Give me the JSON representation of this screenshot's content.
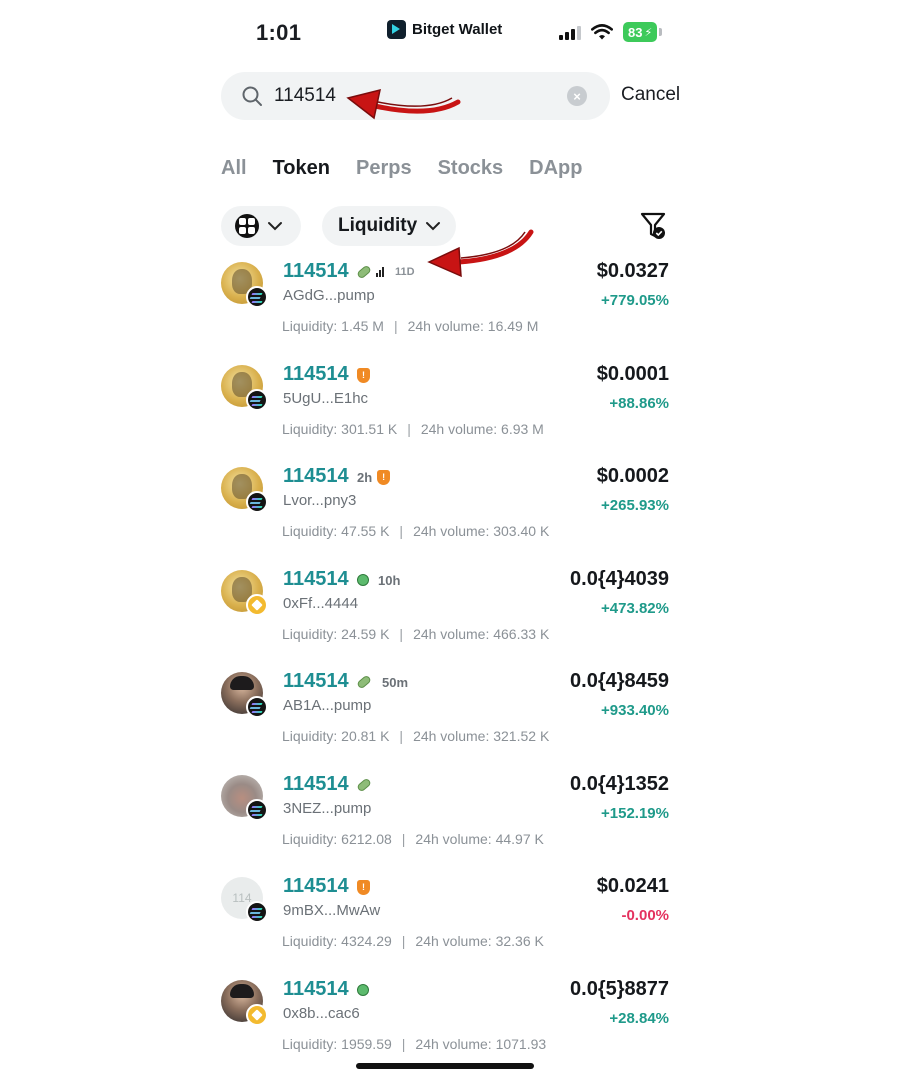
{
  "status_bar": {
    "time": "1:01",
    "brand": "Bitget Wallet",
    "battery": "83"
  },
  "search": {
    "value": "114514",
    "cancel_label": "Cancel"
  },
  "tabs": [
    {
      "label": "All",
      "active": false
    },
    {
      "label": "Token",
      "active": true
    },
    {
      "label": "Perps",
      "active": false
    },
    {
      "label": "Stocks",
      "active": false
    },
    {
      "label": "DApp",
      "active": false
    }
  ],
  "filters": {
    "sort_label": "Liquidity"
  },
  "labels": {
    "liquidity": "Liquidity:",
    "volume": "24h volume:",
    "separator": "|"
  },
  "tokens": [
    {
      "name": "114514",
      "tag": "11D",
      "address": "AGdG...pump",
      "liquidity": "1.45 M",
      "volume": "16.49 M",
      "price": "$0.0327",
      "change": "+779.05%",
      "chain": "solana"
    },
    {
      "name": "114514",
      "tag": "",
      "address": "5UgU...E1hc",
      "liquidity": "301.51 K",
      "volume": "6.93 M",
      "price": "$0.0001",
      "change": "+88.86%",
      "chain": "solana"
    },
    {
      "name": "114514",
      "tag": "2h",
      "address": "Lvor...pny3",
      "liquidity": "47.55 K",
      "volume": "303.40 K",
      "price": "$0.0002",
      "change": "+265.93%",
      "chain": "solana"
    },
    {
      "name": "114514",
      "tag": "10h",
      "address": "0xFf...4444",
      "liquidity": "24.59 K",
      "volume": "466.33 K",
      "price": "0.0{4}4039",
      "change": "+473.82%",
      "chain": "bnb"
    },
    {
      "name": "114514",
      "tag": "50m",
      "address": "AB1A...pump",
      "liquidity": "20.81 K",
      "volume": "321.52 K",
      "price": "0.0{4}8459",
      "change": "+933.40%",
      "chain": "solana"
    },
    {
      "name": "114514",
      "tag": "",
      "address": "3NEZ...pump",
      "liquidity": "6212.08",
      "volume": "44.97 K",
      "price": "0.0{4}1352",
      "change": "+152.19%",
      "chain": "solana"
    },
    {
      "name": "114514",
      "tag": "",
      "avatar_text": "114",
      "address": "9mBX...MwAw",
      "liquidity": "4324.29",
      "volume": "32.36 K",
      "price": "$0.0241",
      "change": "-0.00%",
      "chain": "solana"
    },
    {
      "name": "114514",
      "tag": "",
      "address": "0x8b...cac6",
      "liquidity": "1959.59",
      "volume": "1071.93",
      "price": "0.0{5}8877",
      "change": "+28.84%",
      "chain": "bnb"
    }
  ],
  "colors": {
    "accent_name": "#1e8e92",
    "up": "#1f9a8a",
    "down": "#e4325f",
    "annotation_arrow": "#c81414"
  }
}
